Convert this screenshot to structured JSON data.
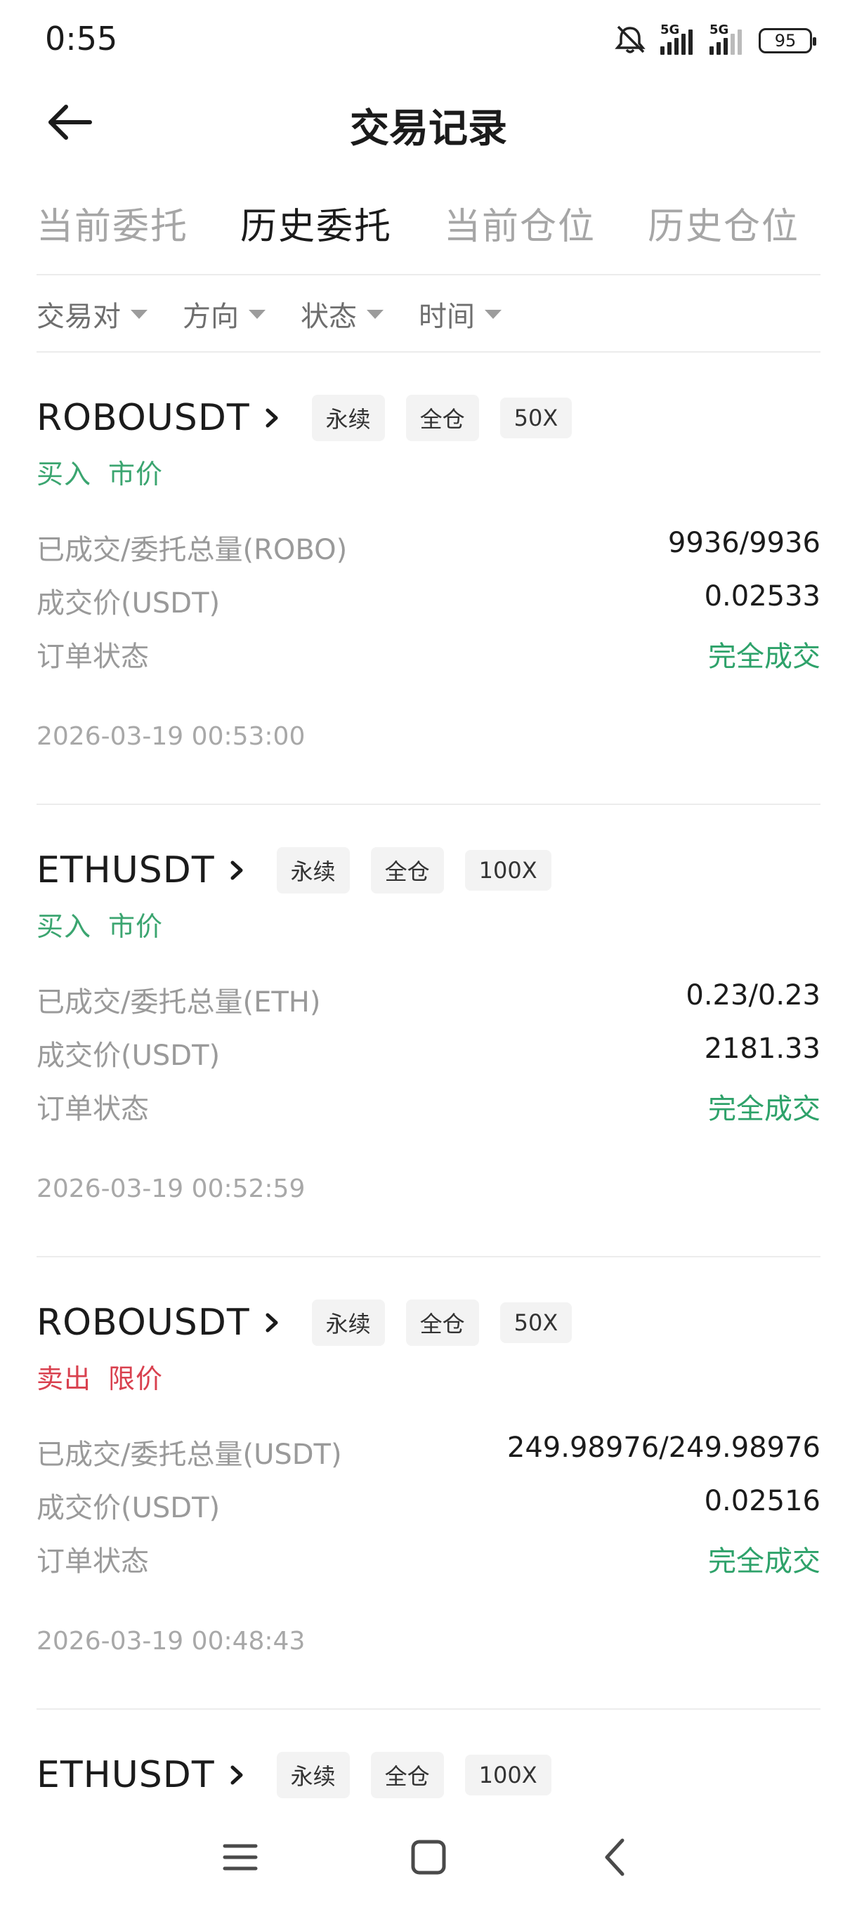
{
  "status_bar": {
    "time": "0:55",
    "net1": "5G",
    "net2": "5G",
    "battery": "95"
  },
  "header": {
    "title": "交易记录"
  },
  "tabs": [
    {
      "label": "当前委托",
      "active": false
    },
    {
      "label": "历史委托",
      "active": true
    },
    {
      "label": "当前仓位",
      "active": false
    },
    {
      "label": "历史仓位",
      "active": false
    }
  ],
  "filters": [
    {
      "label": "交易对"
    },
    {
      "label": "方向"
    },
    {
      "label": "状态"
    },
    {
      "label": "时间"
    }
  ],
  "orders": [
    {
      "symbol": "ROBOUSDT",
      "tags": [
        "永续",
        "全仓",
        "50X"
      ],
      "side": "买入",
      "type": "市价",
      "direction": "buy",
      "filled_label": "已成交/委托总量(ROBO)",
      "filled_value": "9936/9936",
      "price_label": "成交价(USDT)",
      "price_value": "0.02533",
      "status_label": "订单状态",
      "status_value": "完全成交",
      "time": "2026-03-19 00:53:00"
    },
    {
      "symbol": "ETHUSDT",
      "tags": [
        "永续",
        "全仓",
        "100X"
      ],
      "side": "买入",
      "type": "市价",
      "direction": "buy",
      "filled_label": "已成交/委托总量(ETH)",
      "filled_value": "0.23/0.23",
      "price_label": "成交价(USDT)",
      "price_value": "2181.33",
      "status_label": "订单状态",
      "status_value": "完全成交",
      "time": "2026-03-19 00:52:59"
    },
    {
      "symbol": "ROBOUSDT",
      "tags": [
        "永续",
        "全仓",
        "50X"
      ],
      "side": "卖出",
      "type": "限价",
      "direction": "sell",
      "filled_label": "已成交/委托总量(USDT)",
      "filled_value": "249.98976/249.98976",
      "price_label": "成交价(USDT)",
      "price_value": "0.02516",
      "status_label": "订单状态",
      "status_value": "完全成交",
      "time": "2026-03-19 00:48:43"
    },
    {
      "symbol": "ETHUSDT",
      "tags": [
        "永续",
        "全仓",
        "100X"
      ]
    }
  ],
  "colors": {
    "buy": "#3ba570",
    "sell": "#d9414f",
    "status_ok": "#2ea26a"
  }
}
